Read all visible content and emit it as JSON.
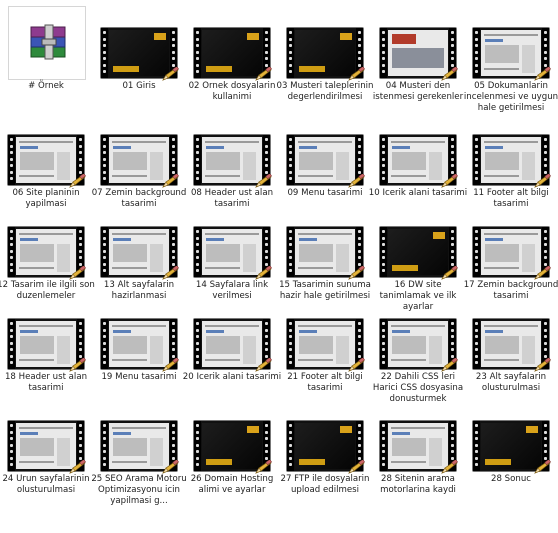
{
  "items": [
    {
      "label": "# Örnek",
      "type": "archive"
    },
    {
      "label": "01 Giris",
      "style": "dark"
    },
    {
      "label": "02 Ornek dosyalarin kullanimi",
      "style": "dark"
    },
    {
      "label": "03 Musteri taleplerinin degerlendirilmesi",
      "style": "dark"
    },
    {
      "label": "04 Musteri den istenmesi gerekenler",
      "style": "photo"
    },
    {
      "label": "05 Dokumanlarin incelenmesi ve uygun hale getirilmesi",
      "style": "light"
    },
    {
      "label": "06 Site planinin yapilmasi",
      "style": "light"
    },
    {
      "label": "07 Zemin background tasarimi",
      "style": "light"
    },
    {
      "label": "08 Header ust alan tasarimi",
      "style": "light"
    },
    {
      "label": "09 Menu tasarimi",
      "style": "light"
    },
    {
      "label": "10 Icerik alani tasarimi",
      "style": "light"
    },
    {
      "label": "11 Footer alt bilgi tasarimi",
      "style": "light"
    },
    {
      "label": "12 Tasarim ile ilgili son duzenlemeler",
      "style": "light"
    },
    {
      "label": "13 Alt sayfalarin hazirlanmasi",
      "style": "light"
    },
    {
      "label": "14 Sayfalara link verilmesi",
      "style": "light"
    },
    {
      "label": "15 Tasarimin sunuma hazir hale getirilmesi",
      "style": "light"
    },
    {
      "label": "16 DW site tanimlamak ve ilk ayarlar",
      "style": "dark"
    },
    {
      "label": "17 Zemin background tasarimi",
      "style": "light"
    },
    {
      "label": "18 Header ust alan tasarimi",
      "style": "light"
    },
    {
      "label": "19 Menu tasarimi",
      "style": "light"
    },
    {
      "label": "20 Icerik alani tasarimi",
      "style": "light"
    },
    {
      "label": "21 Footer alt bilgi tasarimi",
      "style": "light"
    },
    {
      "label": "22 Dahili CSS leri Harici CSS dosyasina donusturmek",
      "style": "light"
    },
    {
      "label": "23 Alt sayfalarin olusturulmasi",
      "style": "light"
    },
    {
      "label": "24 Urun sayfalarinin olusturulmasi",
      "style": "light"
    },
    {
      "label": "25 SEO Arama Motoru Optimizasyonu icin yapilmasi g...",
      "style": "light"
    },
    {
      "label": "26 Domain Hosting alimi ve ayarlar",
      "style": "dark"
    },
    {
      "label": "27 FTP ile dosyalarin upload edilmesi",
      "style": "dark"
    },
    {
      "label": "28 Sitenin arama motorlarina kaydi",
      "style": "light"
    },
    {
      "label": "28 Sonuc",
      "style": "dark"
    }
  ]
}
